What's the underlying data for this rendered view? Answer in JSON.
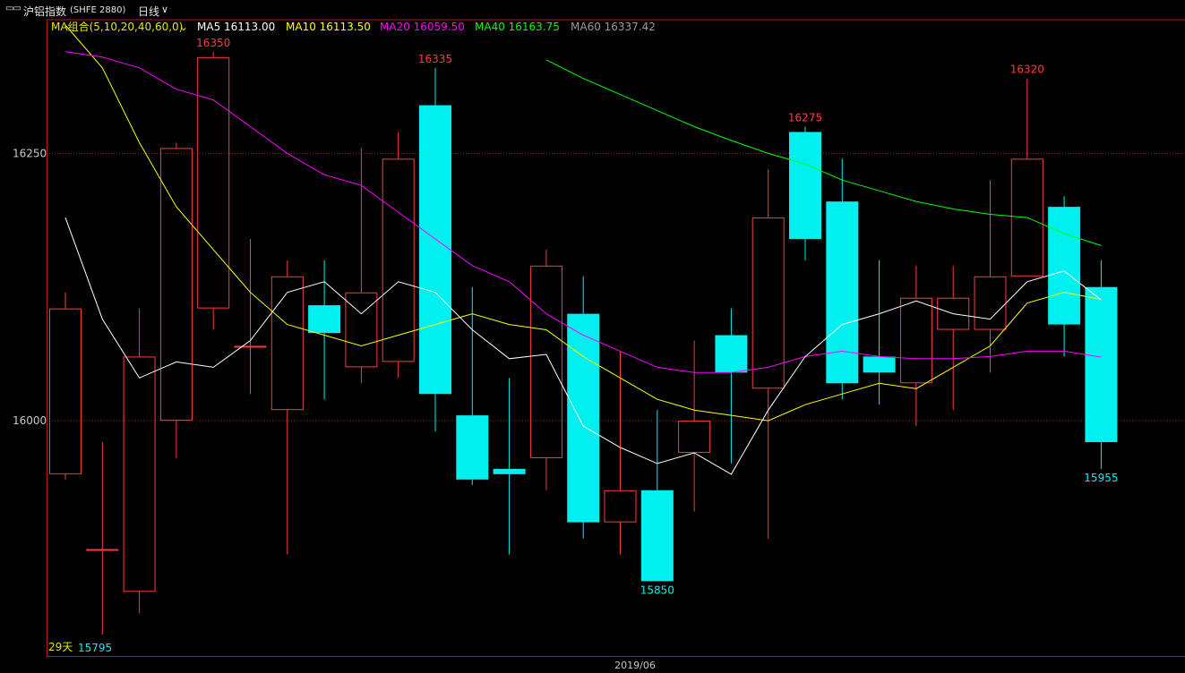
{
  "toolbar": {
    "title": "沪铝指数",
    "code": "(SHFE 2880)",
    "period": "日线",
    "period_arrow": "∨"
  },
  "colors": {
    "up": "#ff3b3b",
    "down": "#00f0f0",
    "ma5": "#ffffff",
    "ma10": "#ffff00",
    "ma20": "#ff00ff",
    "ma40": "#00ff00",
    "ma60": "#9a9a9a",
    "grid": "#a02020",
    "axis_text": "#c8c8c8"
  },
  "chart_data": {
    "type": "candlestick",
    "ylim": [
      15780,
      16375
    ],
    "y_ticks": [
      "16250",
      "16000"
    ],
    "x_tick": "2019/06",
    "ma_legend": {
      "label": "MA组合(5,10,20,40,60,0)",
      "arrow": "⌄",
      "items": [
        {
          "key": "ma5",
          "text": "MA5 16113.00"
        },
        {
          "key": "ma10",
          "text": "MA10 16113.50"
        },
        {
          "key": "ma20",
          "text": "MA20 16059.50"
        },
        {
          "key": "ma40",
          "text": "MA40 16163.75"
        },
        {
          "key": "ma60",
          "text": "MA60 16337.42"
        }
      ]
    },
    "candles": [
      {
        "o": 15950,
        "h": 16120,
        "l": 15945,
        "c": 16105
      },
      {
        "o": 15880,
        "h": 15980,
        "l": 15800,
        "c": 15880
      },
      {
        "o": 15840,
        "h": 16105,
        "l": 15820,
        "c": 16060
      },
      {
        "o": 16000,
        "h": 16260,
        "l": 15965,
        "c": 16255
      },
      {
        "o": 16105,
        "h": 16345,
        "l": 16085,
        "c": 16340
      },
      {
        "o": 16070,
        "h": 16170,
        "l": 16025,
        "c": 16070
      },
      {
        "o": 16010,
        "h": 16150,
        "l": 15875,
        "c": 16135
      },
      {
        "o": 16108,
        "h": 16150,
        "l": 16020,
        "c": 16082
      },
      {
        "o": 16050,
        "h": 16255,
        "l": 16035,
        "c": 16120
      },
      {
        "o": 16055,
        "h": 16270,
        "l": 16040,
        "c": 16245
      },
      {
        "o": 16295,
        "h": 16330,
        "l": 15990,
        "c": 16025
      },
      {
        "o": 16005,
        "h": 16125,
        "l": 15940,
        "c": 15945
      },
      {
        "o": 15955,
        "h": 16040,
        "l": 15875,
        "c": 15950
      },
      {
        "o": 15965,
        "h": 16160,
        "l": 15935,
        "c": 16145
      },
      {
        "o": 16100,
        "h": 16135,
        "l": 15890,
        "c": 15905
      },
      {
        "o": 15905,
        "h": 16065,
        "l": 15875,
        "c": 15935
      },
      {
        "o": 15935,
        "h": 16010,
        "l": 15850,
        "c": 15850
      },
      {
        "o": 15970,
        "h": 16075,
        "l": 15915,
        "c": 16000
      },
      {
        "o": 16080,
        "h": 16105,
        "l": 15960,
        "c": 16045
      },
      {
        "o": 16030,
        "h": 16235,
        "l": 15890,
        "c": 16190
      },
      {
        "o": 16270,
        "h": 16275,
        "l": 16150,
        "c": 16170
      },
      {
        "o": 16205,
        "h": 16245,
        "l": 16020,
        "c": 16035
      },
      {
        "o": 16060,
        "h": 16150,
        "l": 16015,
        "c": 16045
      },
      {
        "o": 16035,
        "h": 16145,
        "l": 15995,
        "c": 16115
      },
      {
        "o": 16085,
        "h": 16145,
        "l": 16010,
        "c": 16115
      },
      {
        "o": 16085,
        "h": 16225,
        "l": 16045,
        "c": 16135
      },
      {
        "o": 16135,
        "h": 16320,
        "l": 16135,
        "c": 16245
      },
      {
        "o": 16200,
        "h": 16210,
        "l": 16060,
        "c": 16090
      },
      {
        "o": 16125,
        "h": 16150,
        "l": 15955,
        "c": 15980
      }
    ],
    "ma5": [
      16190,
      16095,
      16040,
      16055,
      16050,
      16075,
      16120,
      16130,
      16100,
      16130,
      16120,
      16085,
      16058,
      16062,
      15995,
      15975,
      15960,
      15970,
      15950,
      16010,
      16060,
      16090,
      16100,
      16112,
      16100,
      16095,
      16130,
      16140,
      16113
    ],
    "ma20": [
      16345,
      16340,
      16330,
      16310,
      16300,
      16275,
      16250,
      16230,
      16220,
      16195,
      16170,
      16145,
      16130,
      16100,
      16080,
      16065,
      16050,
      16045,
      16045,
      16050,
      16060,
      16065,
      16060,
      16058,
      16058,
      16060,
      16065,
      16065,
      16059.5
    ],
    "ma40": [
      16337.42,
      16320,
      16305,
      16290,
      16275,
      16262,
      16250,
      16240,
      16225,
      16215,
      16205,
      16198,
      16193,
      16190,
      16175,
      16163.75
    ],
    "ma10_end_label": "",
    "ma10": [
      16370,
      16330,
      16260,
      16200,
      16160,
      16120,
      16090,
      16080,
      16070,
      16080,
      16090,
      16100,
      16090,
      16085,
      16060,
      16040,
      16020,
      16010,
      16005,
      16000,
      16015,
      16025,
      16035,
      16030,
      16050,
      16070,
      16110,
      16120,
      16113.5
    ],
    "labels": [
      {
        "idx": 4,
        "text": "16350",
        "kind": "high"
      },
      {
        "idx": 10,
        "text": "16335",
        "kind": "high"
      },
      {
        "idx": 20,
        "text": "16275",
        "kind": "high"
      },
      {
        "idx": 26,
        "text": "16320",
        "kind": "high"
      },
      {
        "idx": 16,
        "text": "15850",
        "kind": "low"
      },
      {
        "idx": 28,
        "text": "15955",
        "kind": "low"
      }
    ],
    "bottom_left": {
      "days": "29天",
      "min": "15795"
    }
  }
}
